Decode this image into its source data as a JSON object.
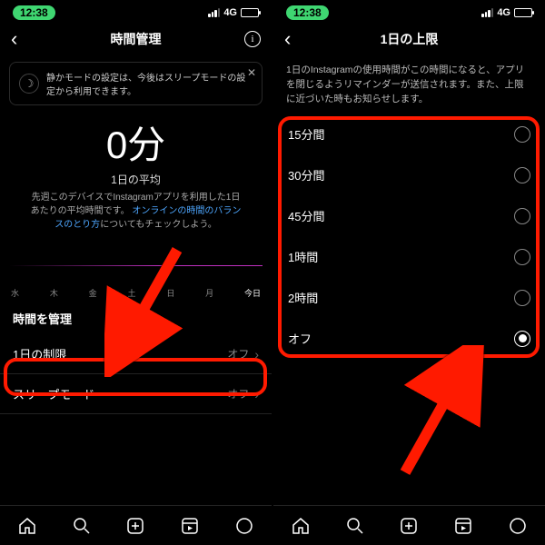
{
  "status": {
    "time": "12:38",
    "net": "4G"
  },
  "left": {
    "title": "時間管理",
    "banner": "静かモードの設定は、今後はスリープモードの設定から利用できます。",
    "bigNumber": "0分",
    "avgLabel": "1日の平均",
    "avgDesc1": "先週このデバイスでInstagramアプリを利用した1日あたりの平均時間です。",
    "avgLink": "オンラインの時間のバランスのとり方",
    "avgDesc2": "についてもチェックしよう。",
    "days": [
      "水",
      "木",
      "金",
      "土",
      "日",
      "月",
      "今日"
    ],
    "sectionTitle": "時間を管理",
    "row1": {
      "label": "1日の制限",
      "value": "オフ"
    },
    "row2": {
      "label": "スリープモード",
      "value": "オフ"
    }
  },
  "right": {
    "title": "1日の上限",
    "desc": "1日のInstagramの使用時間がこの時間になると、アプリを閉じるようリマインダーが送信されます。また、上限に近づいた時もお知らせします。",
    "options": [
      "15分間",
      "30分間",
      "45分間",
      "1時間",
      "2時間",
      "オフ"
    ],
    "selectedIndex": 5
  }
}
